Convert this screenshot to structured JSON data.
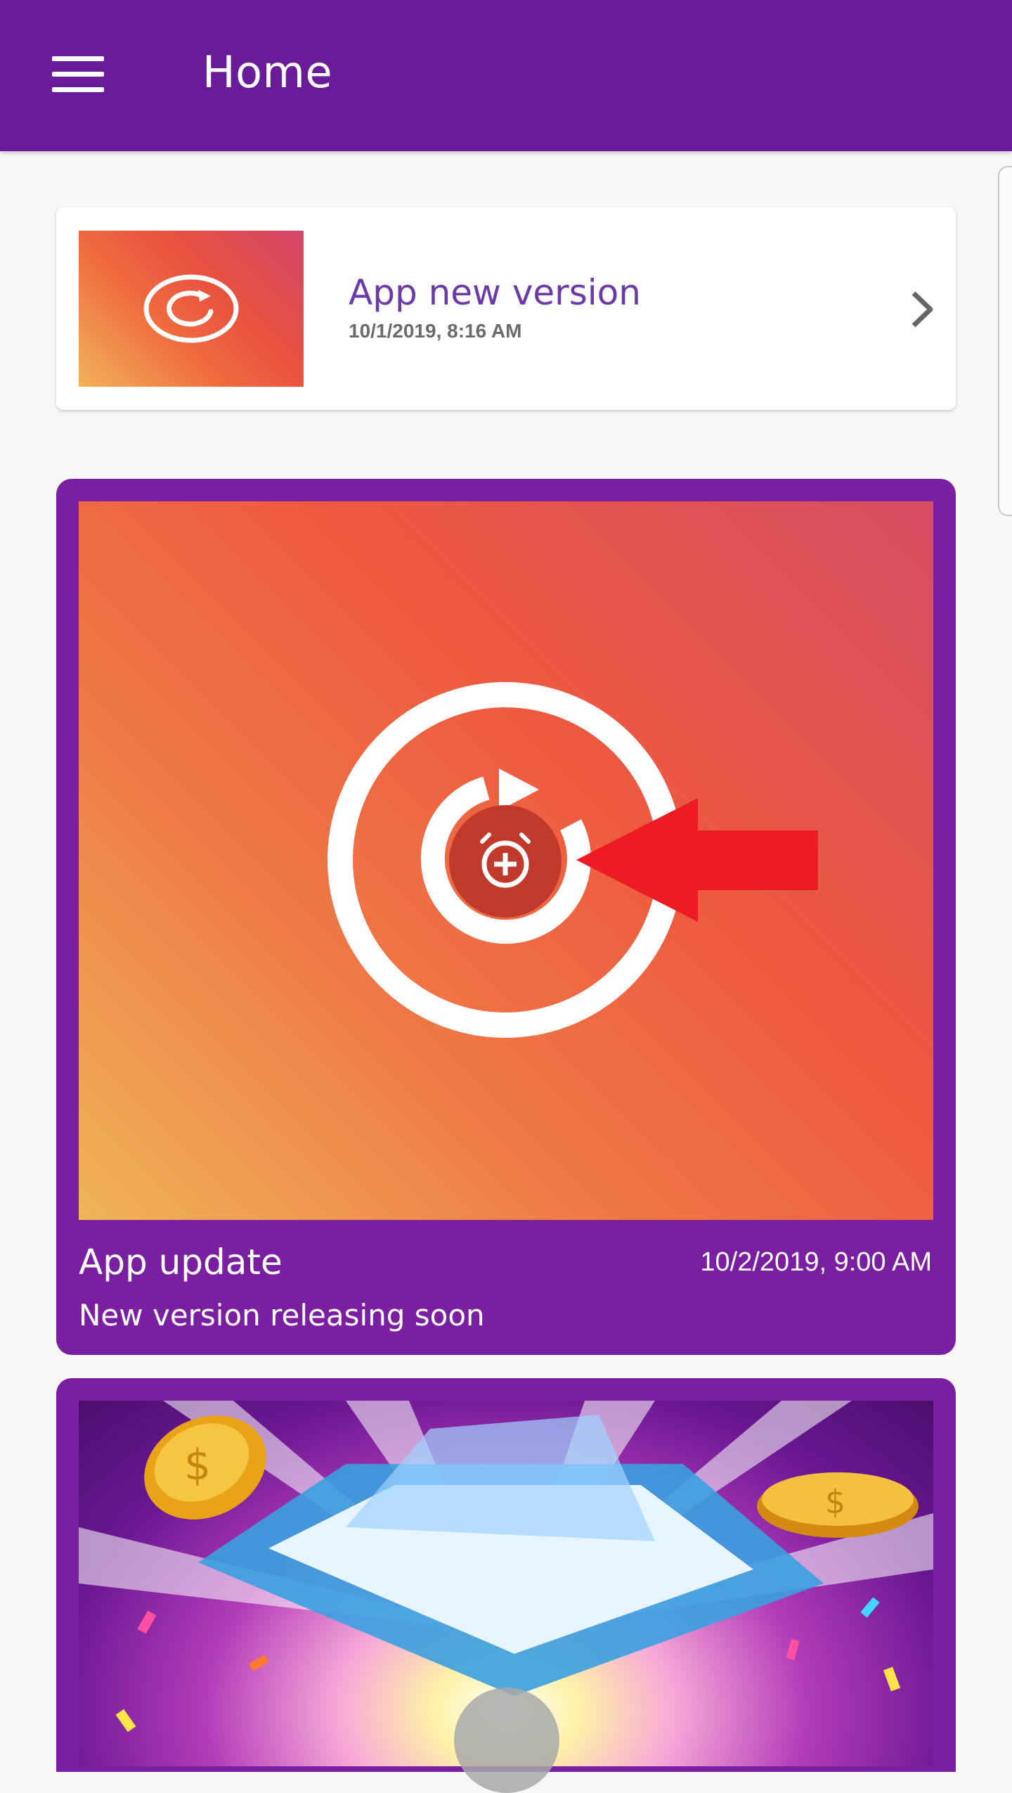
{
  "appbar": {
    "title": "Home",
    "menu_icon": "hamburger-menu-icon"
  },
  "notification": {
    "title": "App new version",
    "date": "10/1/2019, 8:16 AM",
    "thumb_icon": "refresh-circle-icon",
    "chevron_icon": "chevron-right-icon"
  },
  "feature": {
    "title": "App update",
    "date": "10/2/2019, 9:00 AM",
    "subtitle": "New version releasing soon",
    "image_icon": "refresh-alarm-icon",
    "arrow_icon": "red-arrow-left-icon"
  },
  "promo": {
    "image_icon": "gift-box-coins-illustration",
    "play_icon": "play-button-icon"
  },
  "colors": {
    "appbar": "#6a1b9a",
    "card_purple": "#7b1fa2",
    "title_purple": "#6a3aa8",
    "arrow_red": "#ed1c24"
  }
}
